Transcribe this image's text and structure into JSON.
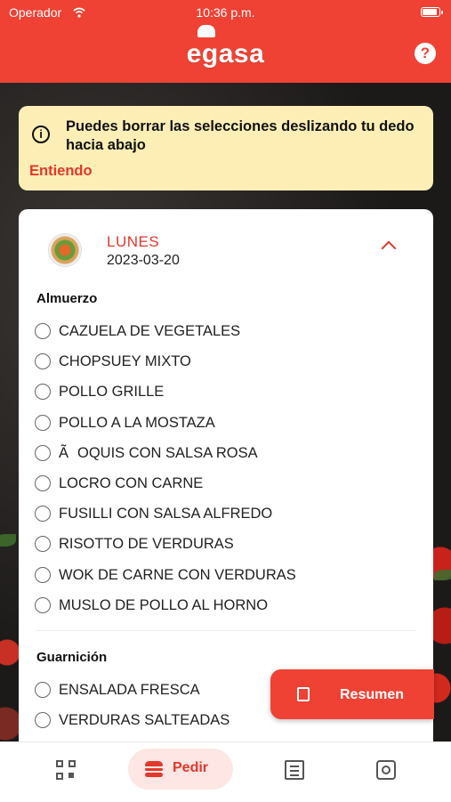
{
  "status_bar": {
    "carrier": "Operador",
    "time": "10:36 p.m."
  },
  "header": {
    "logo_text": "egasa",
    "help_label": "?"
  },
  "banner": {
    "message": "Puedes borrar las selecciones deslizando tu dedo hacia abajo",
    "action_label": "Entiendo"
  },
  "menu_day": {
    "day_name": "LUNES",
    "date": "2023-03-20",
    "sections": [
      {
        "title": "Almuerzo",
        "options": [
          "CAZUELA DE VEGETALES",
          "CHOPSUEY MIXTO",
          "POLLO GRILLE",
          "POLLO A LA MOSTAZA",
          "ÃOQUIS CON SALSA ROSA",
          "LOCRO CON CARNE",
          "FUSILLI CON SALSA ALFREDO",
          "RISOTTO DE VERDURAS",
          "WOK DE CARNE CON VERDURAS",
          "MUSLO DE POLLO AL HORNO"
        ]
      },
      {
        "title": "Guarnición",
        "options": [
          "ENSALADA FRESCA",
          "VERDURAS SALTEADAS"
        ]
      }
    ]
  },
  "fab": {
    "label": "Resumen"
  },
  "tabbar": {
    "items": [
      {
        "icon": "qr-code-icon",
        "label": ""
      },
      {
        "icon": "burger-icon",
        "label": "Pedir"
      },
      {
        "icon": "list-icon",
        "label": ""
      },
      {
        "icon": "gear-icon",
        "label": ""
      }
    ]
  },
  "colors": {
    "brand": "#ef4234",
    "banner_bg": "#fdeeb5",
    "accent_text": "#e2382b"
  }
}
